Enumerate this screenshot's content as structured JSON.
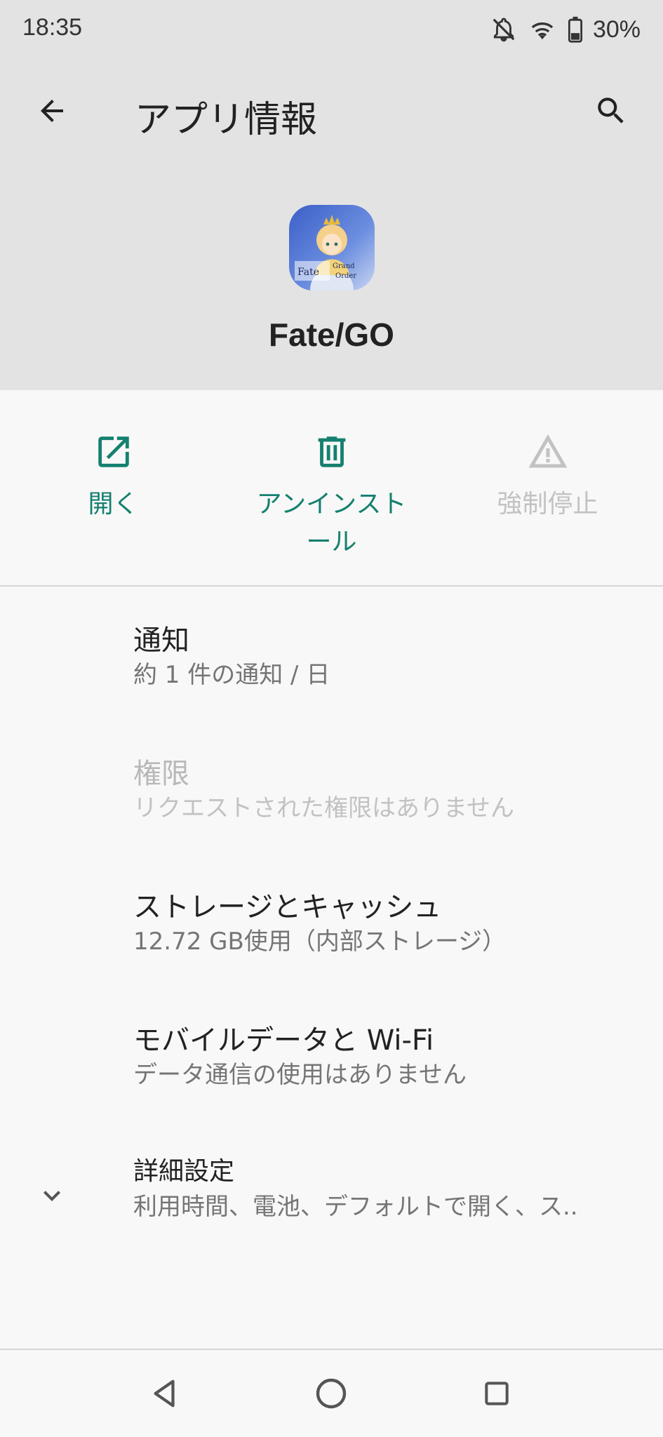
{
  "status_bar": {
    "time": "18:35",
    "battery_percent": "30%",
    "icons": [
      "notifications-off-icon",
      "wifi-icon",
      "battery-icon"
    ]
  },
  "toolbar": {
    "title": "アプリ情報",
    "back_icon": "arrow-back-icon",
    "search_icon": "search-icon"
  },
  "app": {
    "name": "Fate/GO",
    "icon": "fate-grand-order-app-icon"
  },
  "actions": [
    {
      "label": "開く",
      "icon": "open-external-icon",
      "enabled": true
    },
    {
      "label": "アンインストール",
      "line1": "アンインスト",
      "line2": "ール",
      "icon": "trash-icon",
      "enabled": true
    },
    {
      "label": "強制停止",
      "icon": "warning-icon",
      "enabled": false
    }
  ],
  "items": [
    {
      "title": "通知",
      "subtitle": "約 1 件の通知 / 日",
      "enabled": true
    },
    {
      "title": "権限",
      "subtitle": "リクエストされた権限はありません",
      "enabled": false
    },
    {
      "title": "ストレージとキャッシュ",
      "subtitle": "12.72 GB使用（内部ストレージ）",
      "enabled": true
    },
    {
      "title": "モバイルデータと Wi-Fi",
      "subtitle": "データ通信の使用はありません",
      "enabled": true
    },
    {
      "title": "詳細設定",
      "subtitle": "利用時間、電池、デフォルトで開く、ス..",
      "enabled": true,
      "icon": "chevron-down-icon"
    }
  ],
  "nav": {
    "back_icon": "nav-back-icon",
    "home_icon": "nav-home-icon",
    "recents_icon": "nav-recents-icon"
  },
  "colors": {
    "accent": "#15806f",
    "header_bg": "#e3e3e3",
    "body_bg": "#f8f8f8",
    "disabled": "#c2c2c2"
  }
}
